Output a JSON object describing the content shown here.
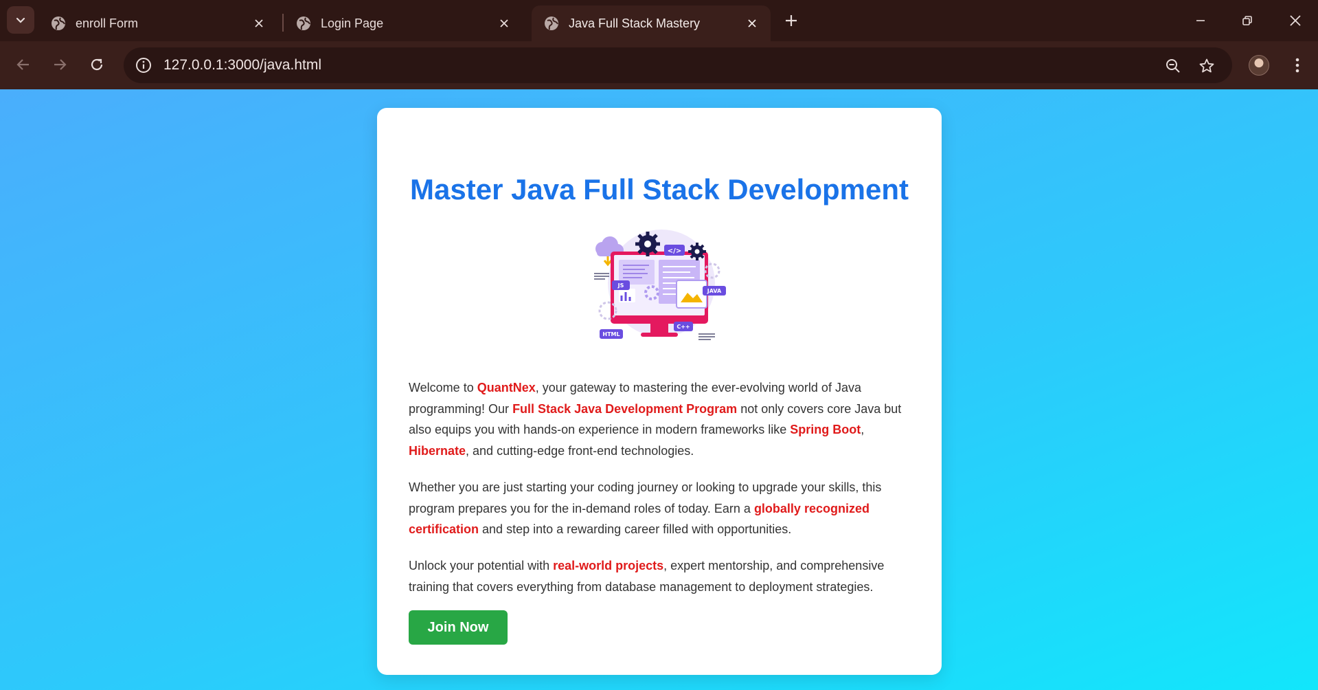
{
  "browser": {
    "tabs": [
      {
        "title": "enroll Form",
        "active": false
      },
      {
        "title": "Login Page",
        "active": false
      },
      {
        "title": "Java Full Stack Mastery",
        "active": true
      }
    ],
    "url": "127.0.0.1:3000/java.html"
  },
  "page": {
    "heading": "Master Java Full Stack Development",
    "illustration_badges": {
      "code": "</>",
      "js": "JS",
      "java": "JAVA",
      "cpp": "C++",
      "html": "HTML"
    },
    "paragraph1": {
      "t1": "Welcome to ",
      "b1": "QuantNex",
      "t2": ", your gateway to mastering the ever-evolving world of Java programming! Our ",
      "b2": "Full Stack Java Development Program",
      "t3": " not only covers core Java but also equips you with hands-on experience in modern frameworks like ",
      "b3": "Spring Boot",
      "t4": ", ",
      "b4": "Hibernate",
      "t5": ", and cutting-edge front-end technologies."
    },
    "paragraph2": {
      "t1": "Whether you are just starting your coding journey or looking to upgrade your skills, this program prepares you for the in-demand roles of today. Earn a ",
      "b1": "globally recognized certification",
      "t2": " and step into a rewarding career filled with opportunities."
    },
    "paragraph3": {
      "t1": "Unlock your potential with ",
      "b1": "real-world projects",
      "t2": ", expert mentorship, and comprehensive training that covers everything from database management to deployment strategies."
    },
    "join_button": "Join Now"
  },
  "colors": {
    "heading": "#1a73e8",
    "highlight": "#e01b1b",
    "button": "#28a745",
    "gradient_start": "#4aaefc",
    "gradient_end": "#12e6fb"
  }
}
